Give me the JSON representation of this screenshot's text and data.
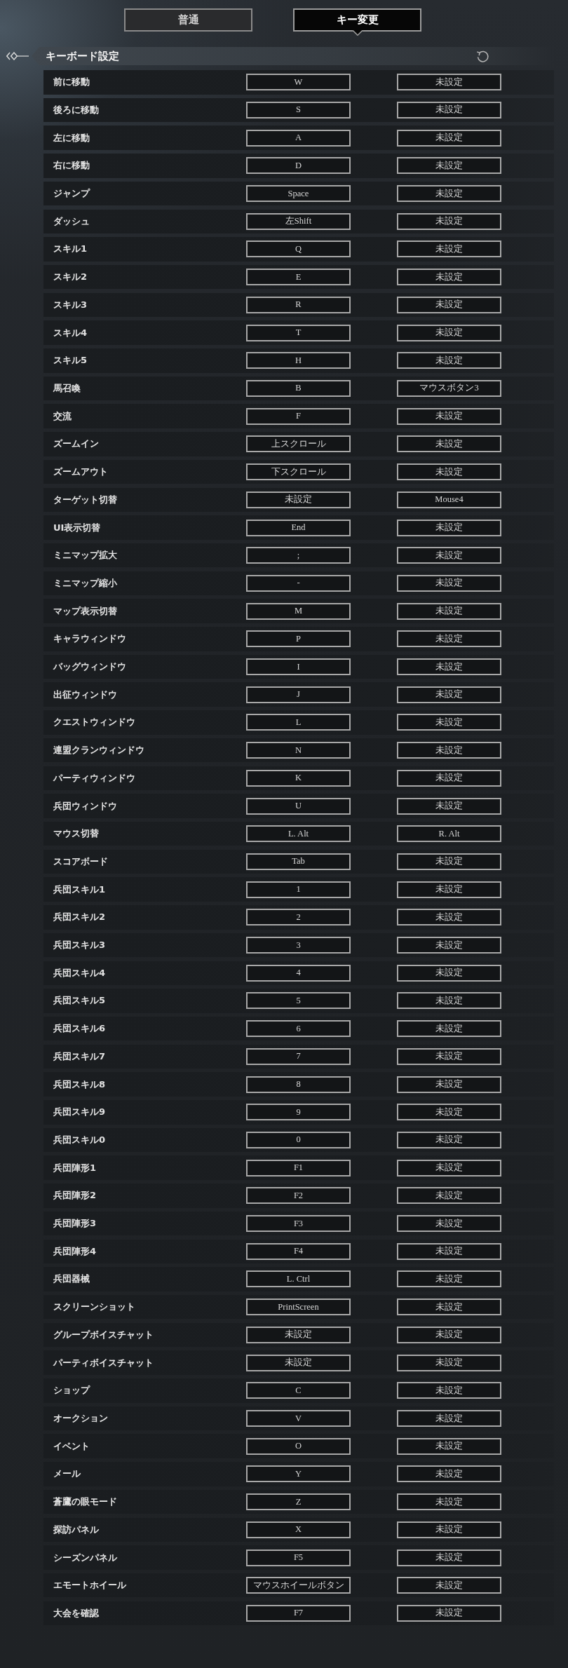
{
  "tabs": [
    {
      "label": "普通",
      "selected": false
    },
    {
      "label": "キー変更",
      "selected": true
    }
  ],
  "section": {
    "title": "キーボード設定"
  },
  "bindings": [
    {
      "action": "前に移動",
      "primary": "W",
      "secondary": "未設定"
    },
    {
      "action": "後ろに移動",
      "primary": "S",
      "secondary": "未設定"
    },
    {
      "action": "左に移動",
      "primary": "A",
      "secondary": "未設定"
    },
    {
      "action": "右に移動",
      "primary": "D",
      "secondary": "未設定"
    },
    {
      "action": "ジャンプ",
      "primary": "Space",
      "secondary": "未設定"
    },
    {
      "action": "ダッシュ",
      "primary": "左Shift",
      "secondary": "未設定"
    },
    {
      "action": "スキル1",
      "primary": "Q",
      "secondary": "未設定"
    },
    {
      "action": "スキル2",
      "primary": "E",
      "secondary": "未設定"
    },
    {
      "action": "スキル3",
      "primary": "R",
      "secondary": "未設定"
    },
    {
      "action": "スキル4",
      "primary": "T",
      "secondary": "未設定"
    },
    {
      "action": "スキル5",
      "primary": "H",
      "secondary": "未設定"
    },
    {
      "action": "馬召喚",
      "primary": "B",
      "secondary": "マウスボタン3"
    },
    {
      "action": "交流",
      "primary": "F",
      "secondary": "未設定"
    },
    {
      "action": "ズームイン",
      "primary": "上スクロール",
      "secondary": "未設定"
    },
    {
      "action": "ズームアウト",
      "primary": "下スクロール",
      "secondary": "未設定"
    },
    {
      "action": "ターゲット切替",
      "primary": "未設定",
      "secondary": "Mouse4"
    },
    {
      "action": "UI表示切替",
      "primary": "End",
      "secondary": "未設定"
    },
    {
      "action": "ミニマップ拡大",
      "primary": ";",
      "secondary": "未設定"
    },
    {
      "action": "ミニマップ縮小",
      "primary": "-",
      "secondary": "未設定"
    },
    {
      "action": "マップ表示切替",
      "primary": "M",
      "secondary": "未設定"
    },
    {
      "action": "キャラウィンドウ",
      "primary": "P",
      "secondary": "未設定"
    },
    {
      "action": "バッグウィンドウ",
      "primary": "I",
      "secondary": "未設定"
    },
    {
      "action": "出征ウィンドウ",
      "primary": "J",
      "secondary": "未設定"
    },
    {
      "action": "クエストウィンドウ",
      "primary": "L",
      "secondary": "未設定"
    },
    {
      "action": "連盟クランウィンドウ",
      "primary": "N",
      "secondary": "未設定"
    },
    {
      "action": "パーティウィンドウ",
      "primary": "K",
      "secondary": "未設定"
    },
    {
      "action": "兵団ウィンドウ",
      "primary": "U",
      "secondary": "未設定"
    },
    {
      "action": "マウス切替",
      "primary": "L. Alt",
      "secondary": "R. Alt"
    },
    {
      "action": "スコアボード",
      "primary": "Tab",
      "secondary": "未設定"
    },
    {
      "action": "兵団スキル1",
      "primary": "1",
      "secondary": "未設定"
    },
    {
      "action": "兵団スキル2",
      "primary": "2",
      "secondary": "未設定"
    },
    {
      "action": "兵団スキル3",
      "primary": "3",
      "secondary": "未設定"
    },
    {
      "action": "兵団スキル4",
      "primary": "4",
      "secondary": "未設定"
    },
    {
      "action": "兵団スキル5",
      "primary": "5",
      "secondary": "未設定"
    },
    {
      "action": "兵団スキル6",
      "primary": "6",
      "secondary": "未設定"
    },
    {
      "action": "兵団スキル7",
      "primary": "7",
      "secondary": "未設定"
    },
    {
      "action": "兵団スキル8",
      "primary": "8",
      "secondary": "未設定"
    },
    {
      "action": "兵団スキル9",
      "primary": "9",
      "secondary": "未設定"
    },
    {
      "action": "兵団スキル0",
      "primary": "0",
      "secondary": "未設定"
    },
    {
      "action": "兵団陣形1",
      "primary": "F1",
      "secondary": "未設定"
    },
    {
      "action": "兵団陣形2",
      "primary": "F2",
      "secondary": "未設定"
    },
    {
      "action": "兵団陣形3",
      "primary": "F3",
      "secondary": "未設定"
    },
    {
      "action": "兵団陣形4",
      "primary": "F4",
      "secondary": "未設定"
    },
    {
      "action": "兵団器械",
      "primary": "L. Ctrl",
      "secondary": "未設定"
    },
    {
      "action": "スクリーンショット",
      "primary": "PrintScreen",
      "secondary": "未設定"
    },
    {
      "action": "グループボイスチャット",
      "primary": "未設定",
      "secondary": "未設定"
    },
    {
      "action": "パーティボイスチャット",
      "primary": "未設定",
      "secondary": "未設定"
    },
    {
      "action": "ショップ",
      "primary": "C",
      "secondary": "未設定"
    },
    {
      "action": "オークション",
      "primary": "V",
      "secondary": "未設定"
    },
    {
      "action": "イベント",
      "primary": "O",
      "secondary": "未設定"
    },
    {
      "action": "メール",
      "primary": "Y",
      "secondary": "未設定"
    },
    {
      "action": "蒼鷹の眼モード",
      "primary": "Z",
      "secondary": "未設定"
    },
    {
      "action": "探訪パネル",
      "primary": "X",
      "secondary": "未設定"
    },
    {
      "action": "シーズンパネル",
      "primary": "F5",
      "secondary": "未設定"
    },
    {
      "action": "エモートホイール",
      "primary": "マウスホイールボタン",
      "secondary": "未設定"
    },
    {
      "action": "大会を確認",
      "primary": "F7",
      "secondary": "未設定"
    }
  ]
}
